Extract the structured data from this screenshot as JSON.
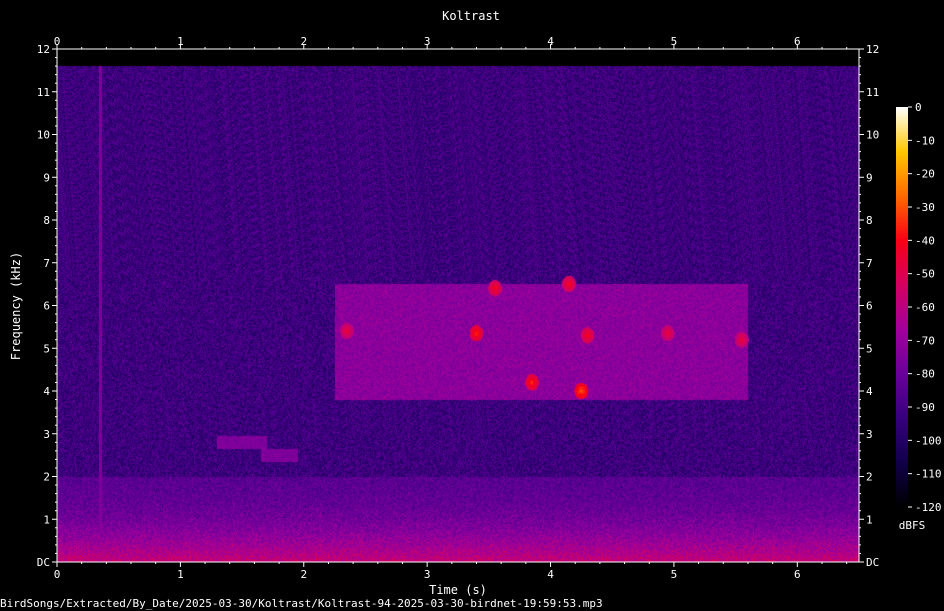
{
  "chart_data": {
    "type": "heatmap",
    "title": "Koltrast",
    "xlabel": "Time (s)",
    "ylabel": "Frequency (kHz)",
    "xlim": [
      0,
      6.5
    ],
    "ylim": [
      0,
      12
    ],
    "x_ticks": [
      "0",
      "1",
      "2",
      "3",
      "4",
      "5",
      "6"
    ],
    "y_ticks": [
      "DC",
      "1",
      "2",
      "3",
      "4",
      "5",
      "6",
      "7",
      "8",
      "9",
      "10",
      "11",
      "12"
    ],
    "colorbar": {
      "label": "dBFS",
      "range": [
        -120,
        0
      ],
      "ticks": [
        "0",
        "-10",
        "-20",
        "-30",
        "-40",
        "-50",
        "-60",
        "-70",
        "-80",
        "-90",
        "-100",
        "-110",
        "-120"
      ],
      "colormap": [
        "#000000",
        "#10004a",
        "#36007e",
        "#6a009a",
        "#a2009c",
        "#d40060",
        "#f80016",
        "#ff6a00",
        "#ffc800",
        "#ffffff"
      ]
    },
    "signal_top_khz": 11.6,
    "features": [
      {
        "kind": "noise_floor_band",
        "f_lo": 0,
        "f_hi": 2,
        "level_db": -55
      },
      {
        "kind": "song_band",
        "t_start": 2.25,
        "t_end": 5.6,
        "f_lo": 3.8,
        "f_hi": 6.5,
        "level_db": -60
      },
      {
        "kind": "chirp",
        "t": 2.35,
        "f": 5.4,
        "level_db": -45
      },
      {
        "kind": "chirp",
        "t": 3.4,
        "f": 5.35,
        "level_db": -35
      },
      {
        "kind": "chirp",
        "t": 3.55,
        "f": 6.4,
        "level_db": -40
      },
      {
        "kind": "chirp",
        "t": 3.85,
        "f": 4.2,
        "level_db": -35
      },
      {
        "kind": "chirp",
        "t": 4.15,
        "f": 6.5,
        "level_db": -40
      },
      {
        "kind": "chirp",
        "t": 4.25,
        "f": 4.0,
        "level_db": -30
      },
      {
        "kind": "chirp",
        "t": 4.3,
        "f": 5.3,
        "level_db": -40
      },
      {
        "kind": "chirp",
        "t": 4.95,
        "f": 5.35,
        "level_db": -45
      },
      {
        "kind": "chirp",
        "t": 5.55,
        "f": 5.2,
        "level_db": -45
      },
      {
        "kind": "click",
        "t": 0.35,
        "f_lo": 0,
        "f_hi": 11.6,
        "level_db": -75
      },
      {
        "kind": "low_call",
        "t_start": 1.3,
        "t_end": 1.7,
        "f": 2.8,
        "level_db": -75
      },
      {
        "kind": "low_call",
        "t_start": 1.65,
        "t_end": 1.95,
        "f": 2.5,
        "level_db": -75
      }
    ]
  },
  "footer": {
    "path": "BirdSongs/Extracted/By_Date/2025-03-30/Koltrast/Koltrast-94-2025-03-30-birdnet-19:59:53.mp3"
  }
}
